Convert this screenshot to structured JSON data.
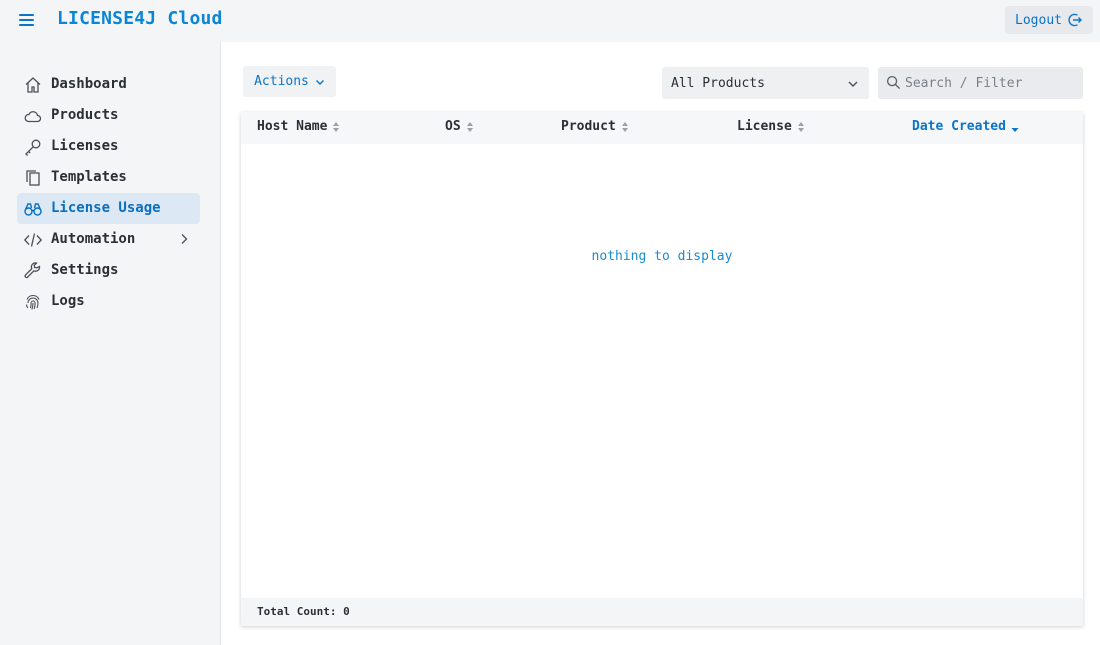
{
  "header": {
    "brand": "LICENSE4J Cloud",
    "logout_label": "Logout"
  },
  "sidebar": {
    "items": [
      {
        "label": "Dashboard",
        "icon": "home-icon"
      },
      {
        "label": "Products",
        "icon": "cloud-icon"
      },
      {
        "label": "Licenses",
        "icon": "key-icon"
      },
      {
        "label": "Templates",
        "icon": "copy-icon"
      },
      {
        "label": "License Usage",
        "icon": "binoculars-icon",
        "active": true
      },
      {
        "label": "Automation",
        "icon": "code-icon",
        "has_submenu": true
      },
      {
        "label": "Settings",
        "icon": "wrench-icon"
      },
      {
        "label": "Logs",
        "icon": "fingerprint-icon"
      }
    ]
  },
  "toolbar": {
    "actions_label": "Actions",
    "product_filter": "All Products",
    "search_placeholder": "Search / Filter"
  },
  "table": {
    "columns": [
      {
        "label": "Host Name",
        "sort": "none"
      },
      {
        "label": "OS",
        "sort": "none"
      },
      {
        "label": "Product",
        "sort": "none"
      },
      {
        "label": "License",
        "sort": "none"
      },
      {
        "label": "Date Created",
        "sort": "desc"
      }
    ],
    "empty_message": "nothing to display",
    "footer": "Total Count: 0"
  },
  "colors": {
    "accent": "#0b74c9",
    "active_bg": "#dde8f5"
  }
}
